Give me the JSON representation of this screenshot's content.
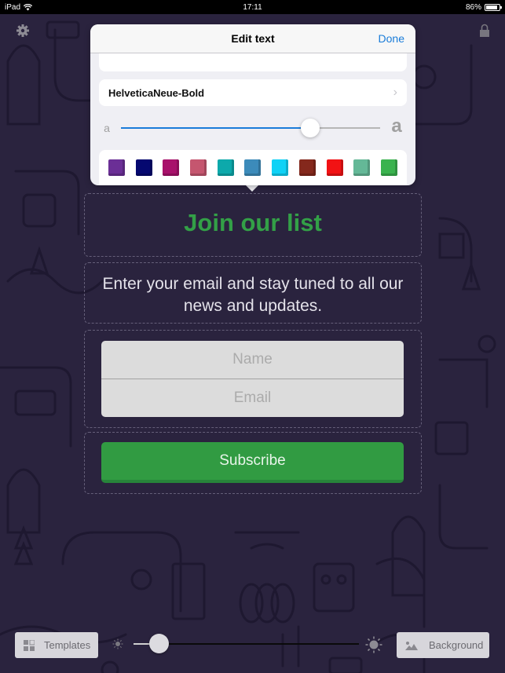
{
  "status_bar": {
    "device": "iPad",
    "time": "17:11",
    "battery_percent_label": "86%",
    "battery_level": 0.86
  },
  "popover": {
    "title": "Edit text",
    "done_label": "Done",
    "font_name": "HelveticaNeue-Bold",
    "size_small_label": "a",
    "size_large_label": "a",
    "size_value": 0.73,
    "accent_color": "#1a7cd9",
    "swatches": [
      {
        "name": "purple",
        "color": "#6b2f96"
      },
      {
        "name": "navy",
        "color": "#050870"
      },
      {
        "name": "magenta",
        "color": "#a8116b"
      },
      {
        "name": "rose",
        "color": "#c5566f"
      },
      {
        "name": "teal",
        "color": "#0da9ab"
      },
      {
        "name": "steel-blue",
        "color": "#3c8bba"
      },
      {
        "name": "cyan",
        "color": "#0fd2f6"
      },
      {
        "name": "brown",
        "color": "#84281c"
      },
      {
        "name": "red",
        "color": "#f21214"
      },
      {
        "name": "sea-green",
        "color": "#64b897"
      },
      {
        "name": "green",
        "color": "#3ab34e"
      }
    ]
  },
  "content": {
    "headline": "Join our list",
    "headline_color": "#33a047",
    "subtext": "Enter your email and stay tuned to all our news and updates.",
    "name_placeholder": "Name",
    "email_placeholder": "Email",
    "subscribe_label": "Subscribe",
    "button_color": "#319b42"
  },
  "toolbar": {
    "templates_label": "Templates",
    "background_label": "Background",
    "brightness_value": 0.11
  }
}
